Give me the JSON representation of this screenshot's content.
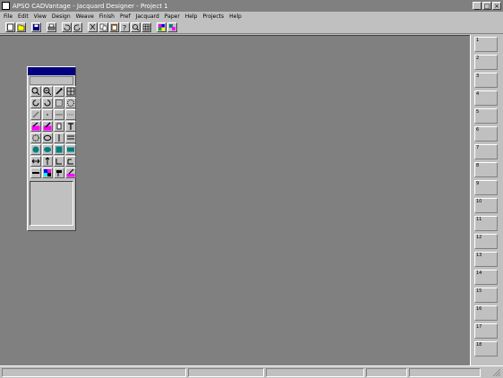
{
  "window": {
    "title": "APSO CADVantage - Jacquard Designer - Project 1",
    "minimize": "_",
    "maximize": "□",
    "close": "×"
  },
  "menu": [
    "File",
    "Edit",
    "View",
    "Design",
    "Weave",
    "Finish",
    "Pref",
    "Jacquard",
    "Paper",
    "Help",
    "Projects",
    "Help"
  ],
  "toolbar": {
    "buttons": [
      "new-icon",
      "open-icon",
      "save-icon",
      "print-icon",
      "undo-icon",
      "redo-icon",
      "cut-icon",
      "copy-icon",
      "paste-icon",
      "help-icon",
      "zoom-icon",
      "grid-icon",
      "color-icon",
      "swap-icon"
    ]
  },
  "palette": {
    "tools": [
      "zoom-in-icon",
      "zoom-out-icon",
      "eyedropper-icon",
      "grid-icon",
      "rotate-icon",
      "rotate-left-icon",
      "select-rect-icon",
      "select-lasso-icon",
      "pencil-icon",
      "dots-icon",
      "line-icon",
      "spray-icon",
      "fill-magenta-icon",
      "brush-magenta-icon",
      "bucket-icon",
      "text-icon",
      "circle-icon",
      "ellipse-icon",
      "vertical-line-icon",
      "horizontal-lines-icon",
      "filled-circle-icon",
      "filled-ellipse-icon",
      "filled-square-icon",
      "filled-rect-icon",
      "horizontal-arrow-icon",
      "vertical-arrow-icon",
      "corner-icon",
      "corner-right-icon",
      "pattern-icon",
      "color-swatch-icon",
      "paint-icon",
      "magenta-brush-icon"
    ]
  },
  "right_panel": {
    "cells": [
      "1",
      "2",
      "3",
      "4",
      "5",
      "6",
      "7",
      "8",
      "9",
      "10",
      "11",
      "12",
      "13",
      "14",
      "15",
      "16",
      "17",
      "18"
    ]
  }
}
